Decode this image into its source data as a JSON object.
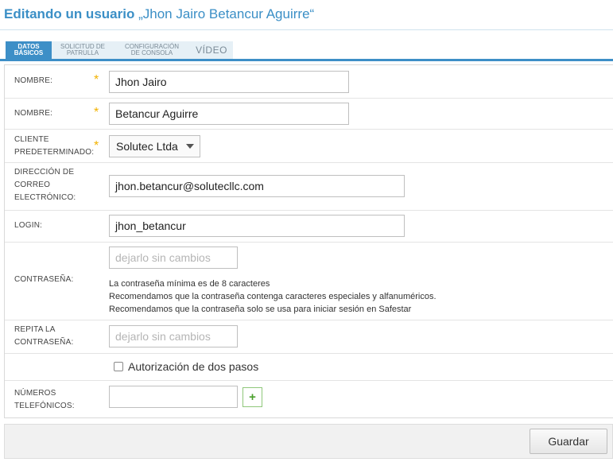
{
  "header": {
    "lead": "Editando un usuario",
    "name": "„Jhon Jairo Betancur Aguirre“"
  },
  "tabs": [
    {
      "line1": "DATOS",
      "line2": "BÁSICOS"
    },
    {
      "line1": "SOLICITUD DE",
      "line2": "PATRULLA"
    },
    {
      "line1": "CONFIGURACIÓN",
      "line2": "DE CONSOLA"
    },
    {
      "label": "VÍDEO"
    }
  ],
  "form": {
    "first_name": {
      "label": "NOMBRE:",
      "required": "*",
      "value": "Jhon Jairo"
    },
    "last_name": {
      "label": "NOMBRE:",
      "required": "*",
      "value": "Betancur Aguirre"
    },
    "client": {
      "label_line1": "CLIENTE",
      "label_line2": "PREDETERMINADO:",
      "required": "*",
      "value": "Solutec Ltda"
    },
    "email": {
      "label_line1": "DIRECCIÓN DE",
      "label_line2": "CORREO",
      "label_line3": "ELECTRÓNICO:",
      "value": "jhon.betancur@solutecllc.com"
    },
    "login": {
      "label": "LOGIN:",
      "value": "jhon_betancur"
    },
    "password": {
      "label": "CONTRASEÑA:",
      "placeholder": "dejarlo sin cambios",
      "hint1": "La contraseña mínima es de 8 caracteres",
      "hint2": "Recomendamos que la contraseña contenga caracteres especiales y alfanuméricos.",
      "hint3": "Recomendamos que la contraseña solo se usa para iniciar sesión en Safestar"
    },
    "repeat_password": {
      "label_line1": "REPITA LA",
      "label_line2": "CONTRASEÑA:",
      "placeholder": "dejarlo sin cambios"
    },
    "two_factor": {
      "label": "Autorización de dos pasos",
      "checked": false
    },
    "phones": {
      "label_line1": "NÚMEROS",
      "label_line2": "TELEFÓNICOS:",
      "add": "+"
    }
  },
  "footer": {
    "save_label": "Guardar"
  },
  "colors": {
    "accent": "#3d8fc7",
    "required_star": "#f2b200",
    "add_green": "#4aa02c"
  },
  "icons": {
    "select_caret": "caret-down-icon",
    "add": "plus-icon",
    "checkbox": "checkbox-icon"
  }
}
